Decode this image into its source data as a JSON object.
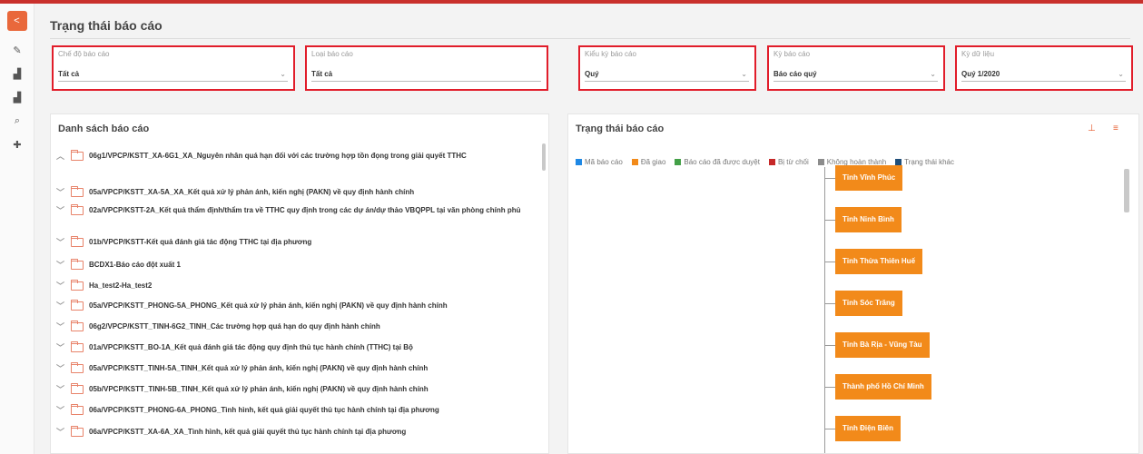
{
  "sidebar": {
    "toggle_icon": "share-icon",
    "items": [
      {
        "name": "edit-icon",
        "glyph": "✎"
      },
      {
        "name": "bar-chart-icon",
        "glyph": "▟"
      },
      {
        "name": "bar-chart-alt-icon",
        "glyph": "▟"
      },
      {
        "name": "search-icon",
        "glyph": "⌕"
      },
      {
        "name": "plus-icon",
        "glyph": "✚"
      }
    ]
  },
  "page": {
    "title": "Trạng thái báo cáo"
  },
  "filters": {
    "che_do": {
      "label": "Chế độ báo cáo",
      "value": "Tất cả"
    },
    "loai": {
      "label": "Loại báo cáo",
      "value": "Tất cả"
    },
    "kieu_ky": {
      "label": "Kiểu kỳ báo cáo",
      "value": "Quý"
    },
    "ky": {
      "label": "Kỳ báo cáo",
      "value": "Báo cáo quý"
    },
    "ky_du_lieu": {
      "label": "Kỳ dữ liệu",
      "value": "Quý 1/2020"
    }
  },
  "list_panel": {
    "title": "Danh sách báo cáo",
    "items": [
      {
        "text": "06g1/VPCP/KSTT_XA-6G1_XA_Nguyên nhân quá hạn đối với các trường hợp tồn đọng trong giải quyết TTHC",
        "expanded": true
      },
      {
        "text": "05a/VPCP/KSTT_XA-5A_XA_Kết quả xử lý phản ánh, kiến nghị (PAKN) về quy định hành chính",
        "expanded": false
      },
      {
        "text": "02a/VPCP/KSTT-2A_Kết quả thẩm định/thẩm tra về TTHC quy định trong các dự án/dự thảo VBQPPL tại văn phòng chính phủ",
        "expanded": false
      },
      {
        "text": "01b/VPCP/KSTT-Kết quả đánh giá tác động TTHC tại địa phương",
        "expanded": false
      },
      {
        "text": "BCDX1-Báo cáo đột xuất 1",
        "expanded": false
      },
      {
        "text": "Ha_test2-Ha_test2",
        "expanded": false
      },
      {
        "text": "05a/VPCP/KSTT_PHONG-5A_PHONG_Kết quả xử lý phản ánh, kiến nghị (PAKN) về quy định hành chính",
        "expanded": false
      },
      {
        "text": "06g2/VPCP/KSTT_TINH-6G2_TINH_Các trường hợp quá hạn do quy định hành chính",
        "expanded": false
      },
      {
        "text": "01a/VPCP/KSTT_BO-1A_Kết quả đánh giá tác động quy định thủ tục hành chính (TTHC) tại Bộ",
        "expanded": false
      },
      {
        "text": "05a/VPCP/KSTT_TINH-5A_TINH_Kết quả xử lý phản ánh, kiến nghị (PAKN) về quy định hành chính",
        "expanded": false
      },
      {
        "text": "05b/VPCP/KSTT_TINH-5B_TINH_Kết quả xử lý phản ánh, kiến nghị (PAKN) về quy định hành chính",
        "expanded": false
      },
      {
        "text": "06a/VPCP/KSTT_PHONG-6A_PHONG_Tình hình, kết quả giải quyết thủ tục hành chính tại địa phương",
        "expanded": false
      },
      {
        "text": "06a/VPCP/KSTT_XA-6A_XA_Tình hình, kết quả giải quyết thủ tục hành chính tại địa phương",
        "expanded": false
      }
    ]
  },
  "status_panel": {
    "title": "Trạng thái báo cáo",
    "icons": {
      "tree": "org-chart-icon",
      "list": "list-icon"
    },
    "legend": [
      {
        "label": "Mã báo cáo",
        "color": "#1e88e5"
      },
      {
        "label": "Đã giao",
        "color": "#f28a1a"
      },
      {
        "label": "Báo cáo đã được duyệt",
        "color": "#43a047"
      },
      {
        "label": "Bị từ chối",
        "color": "#c62828"
      },
      {
        "label": "Không hoàn thành",
        "color": "#8c8c8c"
      },
      {
        "label": "Trạng thái khác",
        "color": "#1f4e79"
      }
    ],
    "nodes": [
      "Tỉnh Vĩnh Phúc",
      "Tỉnh Ninh Bình",
      "Tỉnh Thừa Thiên Huế",
      "Tỉnh Sóc Trăng",
      "Tỉnh Bà Rịa - Vũng Tàu",
      "Thành phố Hồ Chí Minh",
      "Tỉnh Điện Biên"
    ]
  }
}
